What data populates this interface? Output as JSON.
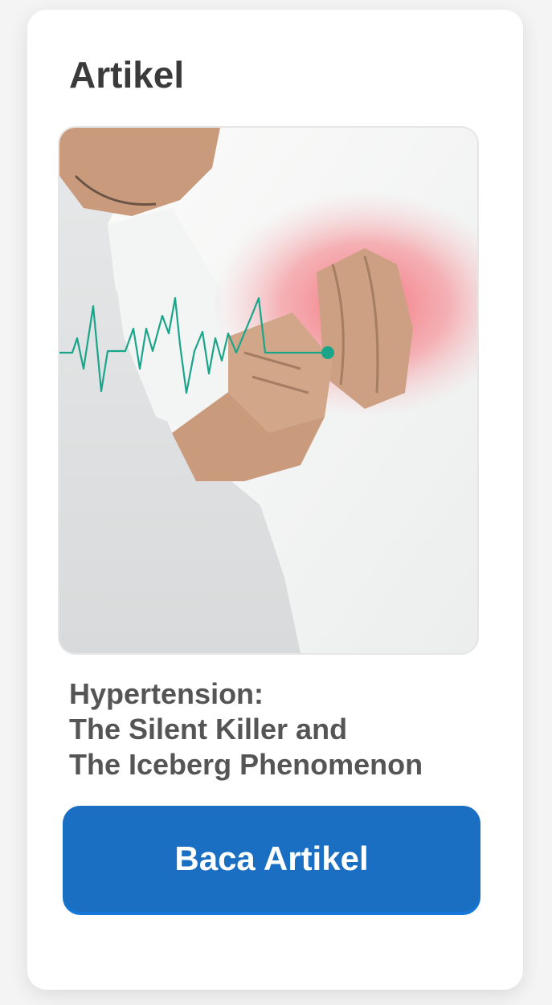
{
  "section": {
    "title": "Artikel"
  },
  "article": {
    "image_subject": "man-clutching-chest-with-heartbeat-line",
    "title_lines": [
      "Hypertension:",
      "The Silent Killer and",
      "The Iceberg Phenomenon"
    ],
    "cta_label": "Baca Artikel"
  },
  "colors": {
    "button": "#1a6fc2",
    "title_text": "#3a3a3a",
    "body_text": "#555555",
    "heartbeat_line": "#1aa58a",
    "pain_highlight": "#f07a80"
  }
}
